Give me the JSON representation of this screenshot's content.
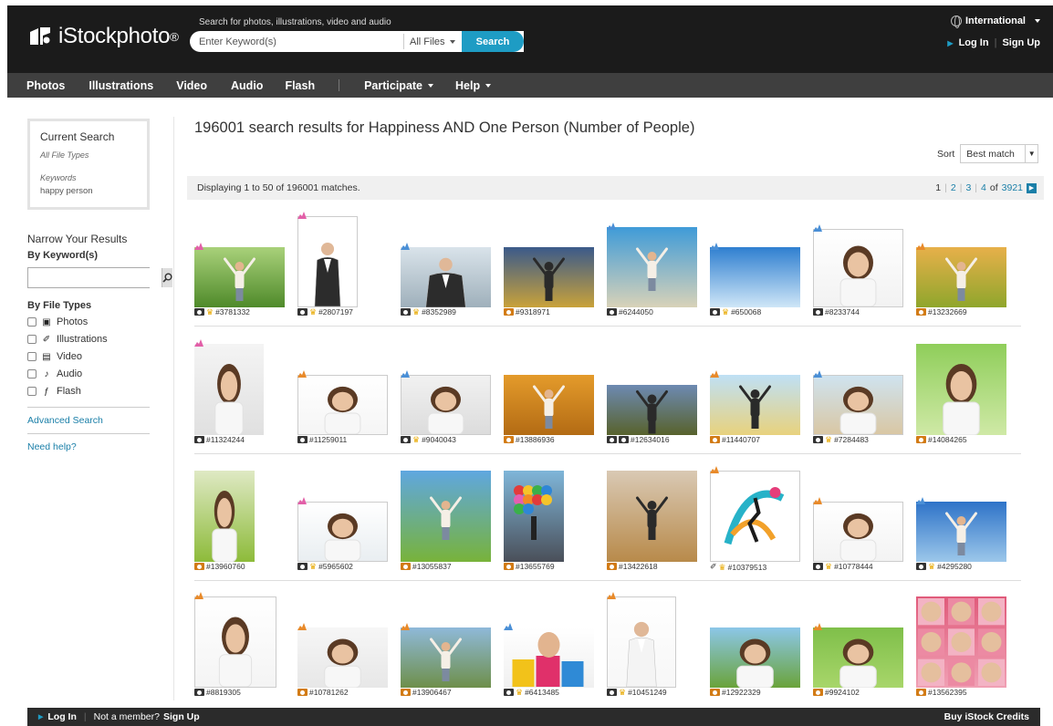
{
  "header": {
    "brand": "iStockphoto",
    "search_caption": "Search for photos, illustrations, video and audio",
    "search_placeholder": "Enter Keyword(s)",
    "file_filter": "All Files",
    "search_button": "Search",
    "international": "International",
    "login": "Log In",
    "signup": "Sign Up"
  },
  "nav": {
    "items": [
      "Photos",
      "Illustrations",
      "Video",
      "Audio",
      "Flash",
      "Participate",
      "Help"
    ]
  },
  "sidebar": {
    "current_search_title": "Current Search",
    "file_types_label": "All File Types",
    "keywords_label": "Keywords",
    "keywords_value": "happy person",
    "narrow_title": "Narrow Your Results",
    "by_keyword": "By Keyword(s)",
    "by_file_types": "By File Types",
    "types": [
      {
        "label": "Photos",
        "icon": "camera-icon"
      },
      {
        "label": "Illustrations",
        "icon": "pen-icon"
      },
      {
        "label": "Video",
        "icon": "video-icon"
      },
      {
        "label": "Audio",
        "icon": "music-note-icon"
      },
      {
        "label": "Flash",
        "icon": "flash-icon"
      }
    ],
    "advanced_search": "Advanced Search",
    "need_help": "Need help?"
  },
  "results": {
    "title": "196001 search results for Happiness AND One Person (Number of People)",
    "sort_label": "Sort",
    "sort_value": "Best match",
    "displaying": "Displaying 1 to 50 of 196001 matches.",
    "pages": [
      "1",
      "2",
      "3",
      "4"
    ],
    "of_label": "of",
    "total_pages": "3921"
  },
  "colors": {
    "accent": "#1e9cc4",
    "link": "#1a7fa8",
    "header_bg": "#1b1b1b",
    "nav_bg": "#3f3f3f",
    "badge_pink": "#e25fa8",
    "badge_blue": "#4a8fd6",
    "badge_orange": "#e88a2a",
    "crown": "#e8a900"
  },
  "images": [
    {
      "id": "#3781332",
      "badge": "pink",
      "scene": "field",
      "crown": true,
      "framed": false,
      "cam": "dark"
    },
    {
      "id": "#2807197",
      "badge": "pink",
      "scene": "businesswoman",
      "crown": true,
      "framed": true,
      "cam": "dark"
    },
    {
      "id": "#8352989",
      "badge": "blue",
      "scene": "office",
      "crown": true,
      "framed": false,
      "cam": "dark"
    },
    {
      "id": "#9318971",
      "badge": "",
      "scene": "sunset",
      "crown": false,
      "framed": false,
      "cam": "orange"
    },
    {
      "id": "#6244050",
      "badge": "blue",
      "scene": "beach",
      "crown": false,
      "framed": false,
      "cam": "dark"
    },
    {
      "id": "#650068",
      "badge": "blue",
      "scene": "sky-lounge",
      "crown": true,
      "framed": false,
      "cam": "dark"
    },
    {
      "id": "#8233744",
      "badge": "blue",
      "scene": "portrait",
      "crown": false,
      "framed": true,
      "cam": "dark"
    },
    {
      "id": "#13232669",
      "badge": "orange",
      "scene": "balloons-field",
      "crown": false,
      "framed": false,
      "cam": "orange"
    },
    {
      "id": "#11324244",
      "badge": "pink",
      "scene": "portrait-white",
      "crown": false,
      "framed": false,
      "cam": "dark"
    },
    {
      "id": "#11259011",
      "badge": "orange",
      "scene": "thumbs-up",
      "crown": false,
      "framed": true,
      "cam": "dark"
    },
    {
      "id": "#9040043",
      "badge": "blue",
      "scene": "laptop",
      "crown": true,
      "framed": true,
      "cam": "dark"
    },
    {
      "id": "#13886936",
      "badge": "",
      "scene": "golden",
      "crown": false,
      "framed": false,
      "cam": "orange"
    },
    {
      "id": "#12634016",
      "badge": "",
      "scene": "dusk",
      "crown": false,
      "framed": false,
      "cam": "video"
    },
    {
      "id": "#11440707",
      "badge": "orange",
      "scene": "sunrise",
      "crown": false,
      "framed": false,
      "cam": "orange"
    },
    {
      "id": "#7284483",
      "badge": "blue",
      "scene": "beach-portrait",
      "crown": true,
      "framed": true,
      "cam": "dark"
    },
    {
      "id": "#14084265",
      "badge": "",
      "scene": "green-portrait",
      "crown": false,
      "framed": false,
      "cam": "orange"
    },
    {
      "id": "#13960760",
      "badge": "",
      "scene": "flowers",
      "crown": false,
      "framed": false,
      "cam": "orange"
    },
    {
      "id": "#5965602",
      "badge": "pink",
      "scene": "bright-portrait",
      "crown": true,
      "framed": true,
      "cam": "dark"
    },
    {
      "id": "#13055837",
      "badge": "",
      "scene": "meadow",
      "crown": false,
      "framed": false,
      "cam": "orange"
    },
    {
      "id": "#13655769",
      "badge": "",
      "scene": "balloons-city",
      "crown": false,
      "framed": false,
      "cam": "orange"
    },
    {
      "id": "#13422618",
      "badge": "",
      "scene": "wheat",
      "crown": false,
      "framed": false,
      "cam": "orange"
    },
    {
      "id": "#10379513",
      "badge": "orange",
      "scene": "illustration",
      "crown": true,
      "framed": true,
      "cam": "pen"
    },
    {
      "id": "#10778444",
      "badge": "orange",
      "scene": "phone",
      "crown": true,
      "framed": true,
      "cam": "dark"
    },
    {
      "id": "#4295280",
      "badge": "blue",
      "scene": "blue-sky",
      "crown": true,
      "framed": false,
      "cam": "dark"
    },
    {
      "id": "#8819305",
      "badge": "orange",
      "scene": "senior",
      "crown": false,
      "framed": true,
      "cam": "dark"
    },
    {
      "id": "#10781262",
      "badge": "orange",
      "scene": "bed",
      "crown": false,
      "framed": false,
      "cam": "orange"
    },
    {
      "id": "#13906467",
      "badge": "orange",
      "scene": "scarf",
      "crown": false,
      "framed": false,
      "cam": "orange"
    },
    {
      "id": "#6413485",
      "badge": "blue",
      "scene": "shopping",
      "crown": true,
      "framed": false,
      "cam": "dark"
    },
    {
      "id": "#10451249",
      "badge": "orange",
      "scene": "doctor",
      "crown": true,
      "framed": true,
      "cam": "dark"
    },
    {
      "id": "#12922329",
      "badge": "",
      "scene": "sun-hat",
      "crown": false,
      "framed": false,
      "cam": "orange"
    },
    {
      "id": "#9924102",
      "badge": "orange",
      "scene": "park-portrait",
      "crown": false,
      "framed": false,
      "cam": "orange"
    },
    {
      "id": "#13562395",
      "badge": "",
      "scene": "grid-faces",
      "crown": false,
      "framed": false,
      "cam": "orange"
    }
  ],
  "footer": {
    "login": "Log In",
    "not_member": "Not a member?",
    "signup": "Sign Up",
    "buy_credits": "Buy iStock Credits"
  }
}
